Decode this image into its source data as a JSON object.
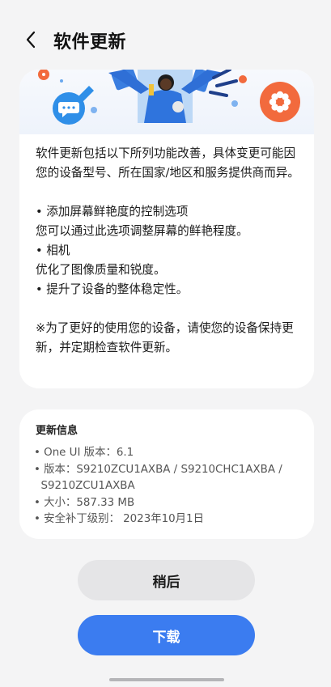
{
  "header": {
    "title": "软件更新"
  },
  "description": {
    "intro": "软件更新包括以下所列功能改善，具体变更可能因您的设备型号、所在国家/地区和服务提供商而异。",
    "items": [
      "• 添加屏幕鲜艳度的控制选项",
      "您可以通过此选项调整屏幕的鲜艳程度。",
      "• 相机",
      "优化了图像质量和锐度。",
      "• 提升了设备的整体稳定性。"
    ],
    "note": "※为了更好的使用您的设备，请使您的设备保持更新，并定期检查软件更新。"
  },
  "update_info": {
    "title": "更新信息",
    "lines": [
      "• One UI 版本：6.1",
      "• 版本：S9210ZCU1AXBA / S9210CHC1AXBA /",
      "  S9210ZCU1AXBA",
      "• 大小：587.33 MB",
      "• 安全补丁级别： 2023年10月1日"
    ]
  },
  "buttons": {
    "later": "稍后",
    "download": "下载"
  },
  "colors": {
    "background": "#f4f4f5",
    "card": "#ffffff",
    "primary_button": "#3b7cf0",
    "secondary_button": "#e5e5e7",
    "illustration_blue": "#2f8fe8",
    "illustration_orange": "#f26a3d"
  },
  "icons": {
    "back": "chevron-left-icon",
    "chat_bubble": "chat-bubble-icon",
    "flower": "flower-icon"
  }
}
